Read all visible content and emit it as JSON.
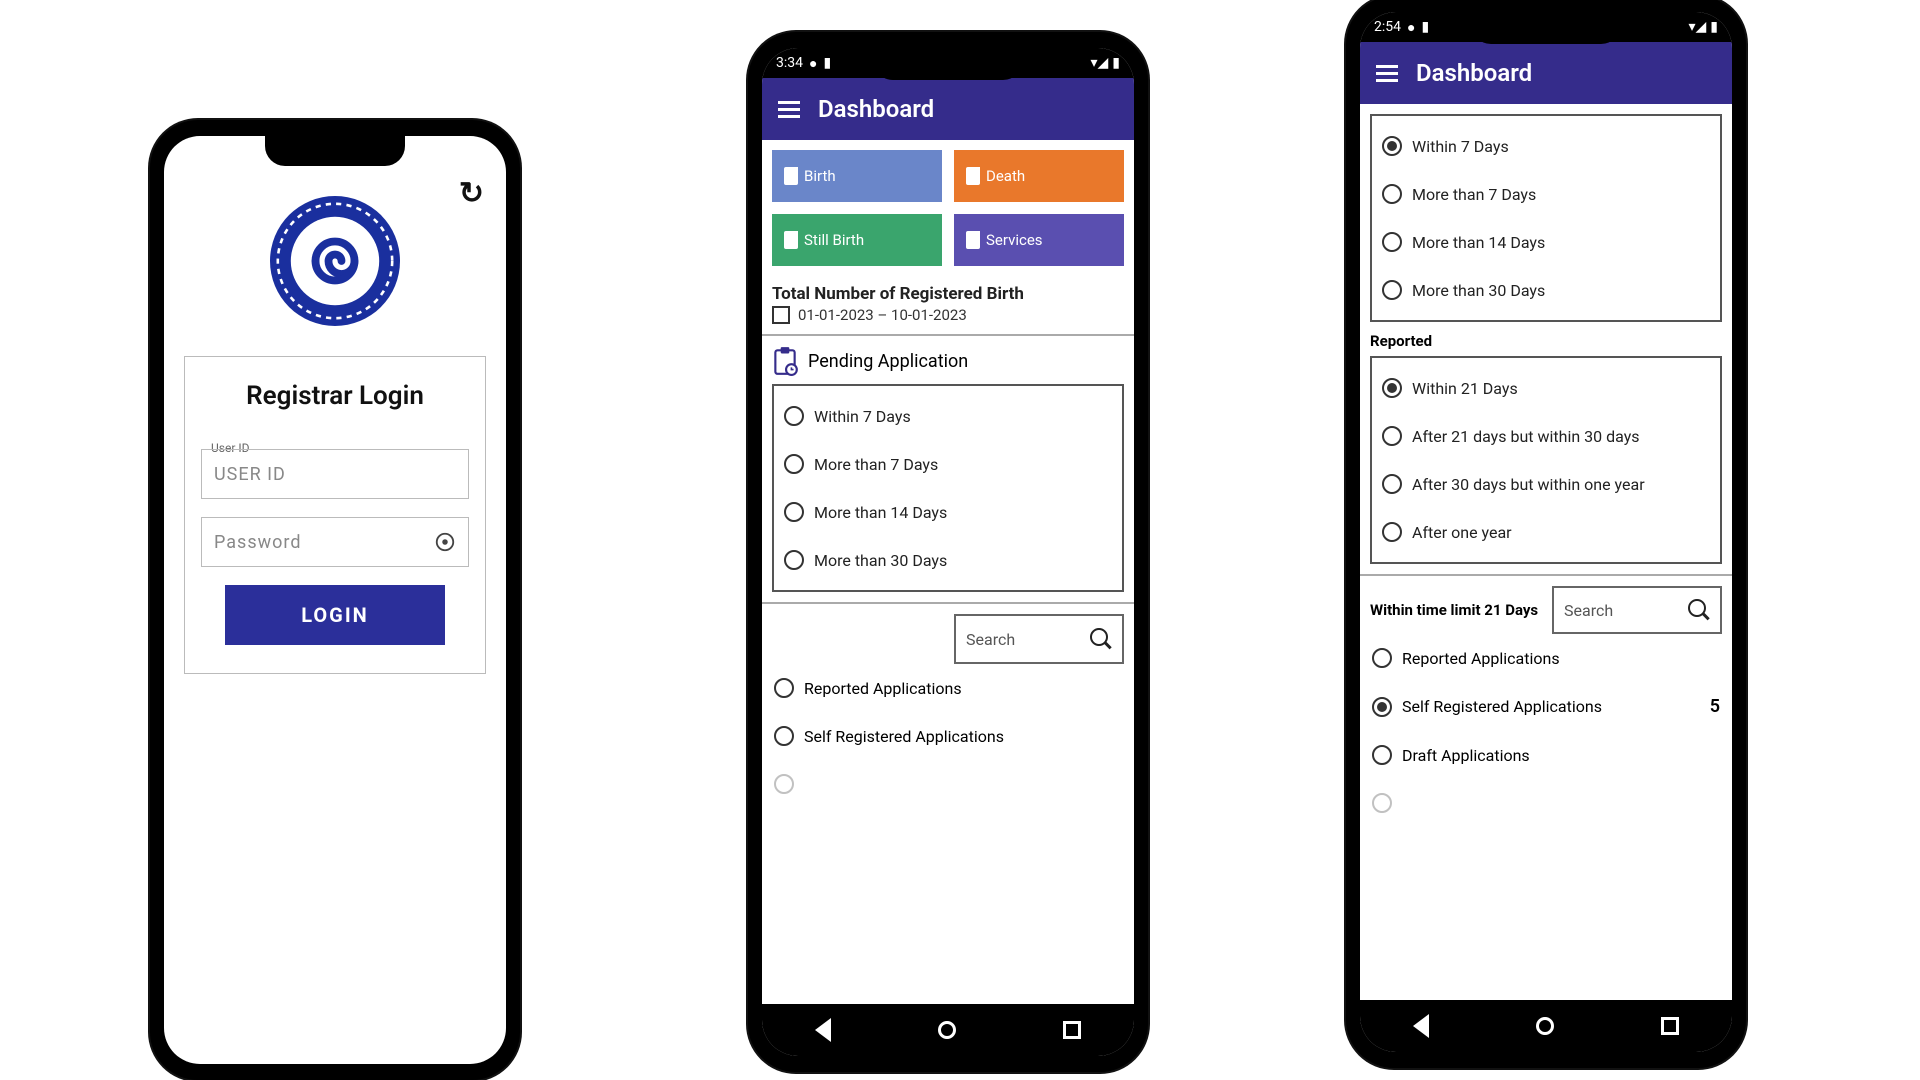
{
  "phone1": {
    "refresh_glyph": "↻",
    "title": "Registrar Login",
    "user_label": "User ID",
    "user_placeholder": "USER ID",
    "pwd_placeholder": "Password",
    "login_label": "LOGIN"
  },
  "phone2": {
    "status_time": "3:34",
    "appbar_title": "Dashboard",
    "tiles": {
      "a": "Birth",
      "b": "Death",
      "c": "Still Birth",
      "d": "Services"
    },
    "section_total": "Total Number of Registered Birth",
    "date_range": "01-01-2023 – 10-01-2023",
    "pending_title": "Pending Application",
    "pending_opts": [
      "Within 7 Days",
      "More than 7 Days",
      "More than 14 Days",
      "More than 30 Days"
    ],
    "search_ph": "Search",
    "app_opts": [
      "Reported Applications",
      "Self Registered Applications"
    ]
  },
  "phone3": {
    "status_time": "2:54",
    "appbar_title": "Dashboard",
    "group1_opts": [
      "Within 7 Days",
      "More than 7 Days",
      "More than 14 Days",
      "More than 30 Days"
    ],
    "group1_selected_index": 0,
    "reported_label": "Reported",
    "group2_opts": [
      "Within 21 Days",
      "After 21 days but within 30 days",
      "After 30 days but within one year",
      "After one year"
    ],
    "group2_selected_index": 0,
    "filter_title": "Within time limit 21 Days",
    "search_ph": "Search",
    "group3": [
      {
        "label": "Reported Applications",
        "selected": false,
        "count": ""
      },
      {
        "label": "Self Registered Applications",
        "selected": true,
        "count": "5"
      },
      {
        "label": "Draft Applications",
        "selected": false,
        "count": ""
      }
    ]
  }
}
